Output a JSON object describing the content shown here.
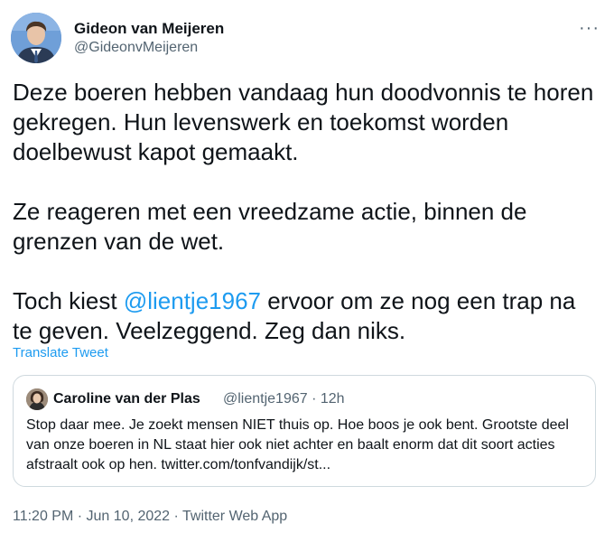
{
  "author": {
    "display_name": "Gideon van Meijeren",
    "handle": "@GideonvMeijeren",
    "avatar_icon": "profile-photo"
  },
  "more_icon": "more-dots-icon",
  "more_glyph": "···",
  "tweet": {
    "p1": "Deze boeren hebben vandaag hun doodvonnis te horen gekregen. Hun levenswerk en toekomst worden doelbewust kapot gemaakt.",
    "p2": "Ze reageren met een vreedzame actie, binnen de grenzen van de wet.",
    "p3_before": "Toch kiest ",
    "p3_mention": "@lientje1967",
    "p3_after": " ervoor om ze nog een trap na te geven. Veelzeggend. Zeg dan niks."
  },
  "translate_label": "Translate Tweet",
  "quote": {
    "display_name": "Caroline van der Plas",
    "handle": "@lientje1967",
    "separator": "·",
    "time": "12h",
    "text": "Stop daar mee. Je zoekt mensen NIET thuis op. Hoe boos je ook bent. Grootste deel van onze boeren in NL staat hier ook niet achter en baalt enorm dat dit soort acties afstraalt ook op hen. twitter.com/tonfvandijk/st..."
  },
  "footer": {
    "time": "11:20 PM",
    "sep1": "·",
    "date": "Jun 10, 2022",
    "sep2": "·",
    "source": "Twitter Web App"
  },
  "colors": {
    "link": "#1d9bf0",
    "text": "#0f1419",
    "muted": "#536471",
    "border": "#cfd9de"
  }
}
